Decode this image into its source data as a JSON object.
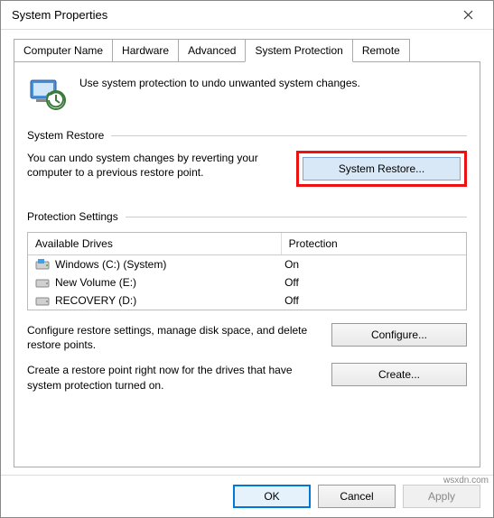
{
  "window": {
    "title": "System Properties"
  },
  "tabs": {
    "t0": "Computer Name",
    "t1": "Hardware",
    "t2": "Advanced",
    "t3": "System Protection",
    "t4": "Remote"
  },
  "intro": {
    "text": "Use system protection to undo unwanted system changes."
  },
  "restore": {
    "heading": "System Restore",
    "desc": "You can undo system changes by reverting your computer to a previous restore point.",
    "button": "System Restore..."
  },
  "protection": {
    "heading": "Protection Settings",
    "col_drives": "Available Drives",
    "col_protection": "Protection",
    "rows": [
      {
        "name": "Windows (C:) (System)",
        "status": "On"
      },
      {
        "name": "New Volume (E:)",
        "status": "Off"
      },
      {
        "name": "RECOVERY (D:)",
        "status": "Off"
      }
    ],
    "configure_desc": "Configure restore settings, manage disk space, and delete restore points.",
    "configure_btn": "Configure...",
    "create_desc": "Create a restore point right now for the drives that have system protection turned on.",
    "create_btn": "Create..."
  },
  "footer": {
    "ok": "OK",
    "cancel": "Cancel",
    "apply": "Apply"
  },
  "watermark": "wsxdn.com"
}
